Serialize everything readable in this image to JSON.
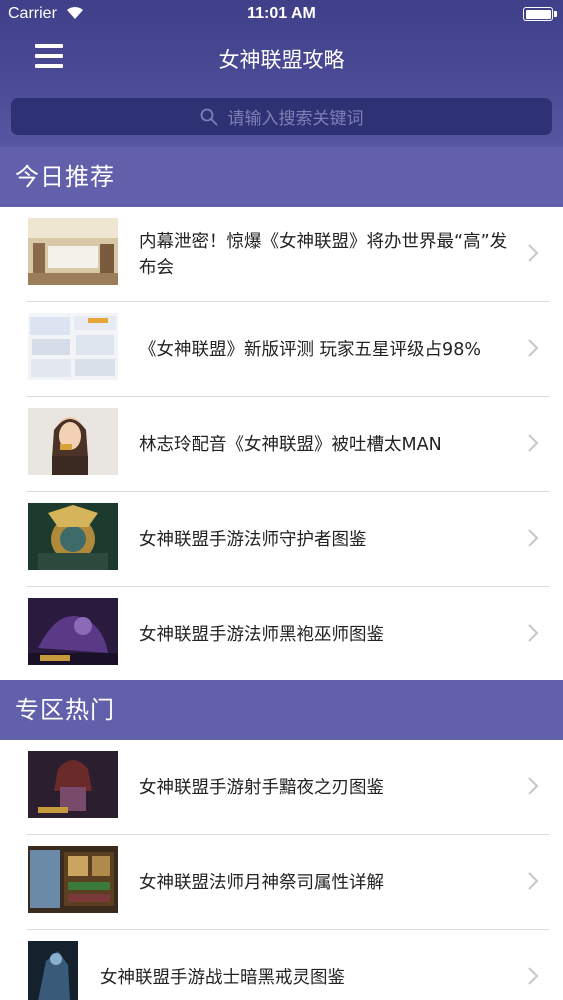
{
  "status_bar": {
    "carrier": "Carrier",
    "time": "11:01 AM"
  },
  "nav": {
    "title": "女神联盟攻略"
  },
  "search": {
    "placeholder": "请输入搜索关键词"
  },
  "sections": [
    {
      "title": "今日推荐",
      "items": [
        {
          "title": "内幕泄密！惊爆《女神联盟》将办世界最“高”发布会"
        },
        {
          "title": "《女神联盟》新版评测 玩家五星评级占98%"
        },
        {
          "title": "林志玲配音《女神联盟》被吐槽太MAN"
        },
        {
          "title": "女神联盟手游法师守护者图鉴"
        },
        {
          "title": "女神联盟手游法师黑袍巫师图鉴"
        }
      ]
    },
    {
      "title": "专区热门",
      "items": [
        {
          "title": "女神联盟手游射手黯夜之刃图鉴"
        },
        {
          "title": "女神联盟法师月神祭司属性详解"
        },
        {
          "title": "女神联盟手游战士暗黑戒灵图鉴"
        }
      ]
    }
  ],
  "colors": {
    "nav_bg": "#46468f",
    "section_bg": "#6260ab",
    "search_bg": "#2f3175"
  }
}
